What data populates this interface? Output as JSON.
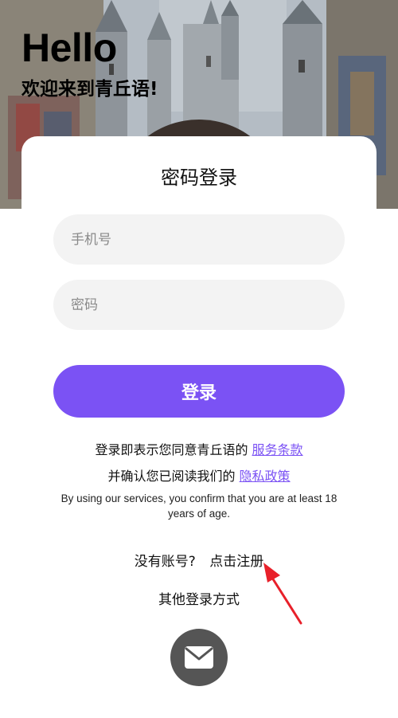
{
  "header": {
    "hello": "Hello",
    "welcome": "欢迎来到青丘语!"
  },
  "card": {
    "title": "密码登录",
    "phone_placeholder": "手机号",
    "password_placeholder": "密码",
    "login_label": "登录"
  },
  "agreement": {
    "line1_prefix": "登录即表示您同意青丘语的",
    "terms_link": "服务条款",
    "line2_prefix": "并确认您已阅读我们的",
    "privacy_link": "隐私政策",
    "age_notice": "By using our services, you confirm that you are at least 18 years of age."
  },
  "register": {
    "question": "没有账号?",
    "link": "点击注册"
  },
  "other_login": {
    "label": "其他登录方式",
    "icons": [
      "mail-icon"
    ]
  },
  "colors": {
    "accent": "#7b52f4",
    "highlight": "#c6b4f7",
    "annotation_arrow": "#e8202a"
  }
}
